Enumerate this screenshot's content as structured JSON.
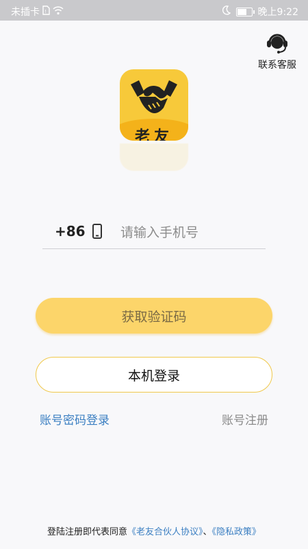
{
  "status_bar": {
    "carrier": "未插卡",
    "time": "晚上9:22"
  },
  "support": {
    "label": "联系客服",
    "icon": "headset-icon"
  },
  "logo": {
    "text": "老友",
    "icon": "handshake-icon",
    "colors": {
      "bg": "#f7c93a",
      "band": "#f4b21a"
    }
  },
  "login_form": {
    "country_code": "+86",
    "phone_placeholder": "请输入手机号"
  },
  "buttons": {
    "get_code": "获取验证码",
    "local_login": "本机登录"
  },
  "links": {
    "password_login": "账号密码登录",
    "register": "账号注册"
  },
  "agreement": {
    "prefix": "登陆注册即代表同意",
    "partner_agreement": "《老友合伙人协议》",
    "separator": "、",
    "privacy_policy": "《隐私政策》"
  },
  "colors": {
    "accent": "#fcd56a",
    "border_accent": "#f0c84a",
    "link": "#3b7fc2"
  }
}
